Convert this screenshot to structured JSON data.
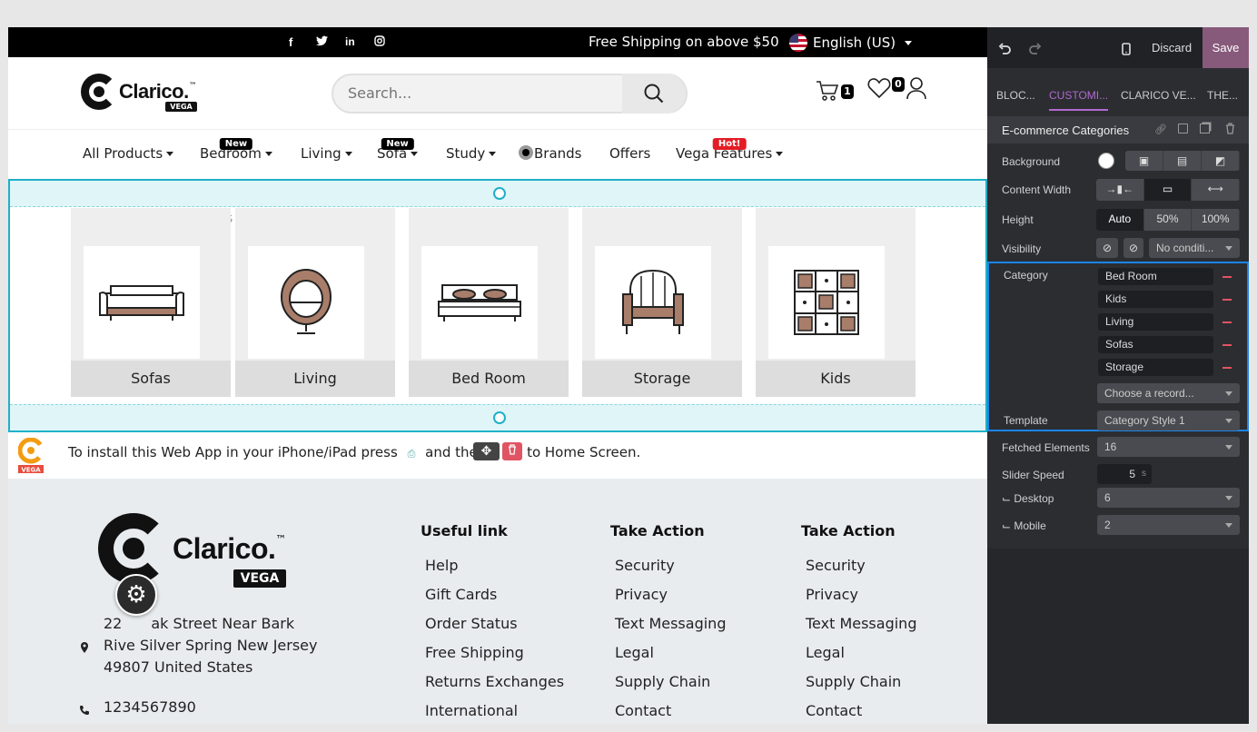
{
  "topbar": {
    "shipping_text": "Free Shipping on above $50",
    "language": "English (US)",
    "social_icons": [
      "facebook-icon",
      "twitter-icon",
      "linkedin-icon",
      "instagram-icon"
    ]
  },
  "header": {
    "logo_text": "Clarico.",
    "logo_tm": "™",
    "logo_sub": "VEGA",
    "search_placeholder": "Search...",
    "cart_count": "1",
    "wishlist_count": "0"
  },
  "nav": {
    "items": [
      {
        "label": "All Products",
        "caret": true,
        "tag": ""
      },
      {
        "label": "Bedroom",
        "caret": true,
        "tag": "New"
      },
      {
        "label": "Living",
        "caret": true,
        "tag": ""
      },
      {
        "label": "Sofa",
        "caret": true,
        "tag": "New"
      },
      {
        "label": "Study",
        "caret": true,
        "tag": ""
      },
      {
        "label": "Brands",
        "caret": false,
        "tag": ""
      },
      {
        "label": "Offers",
        "caret": false,
        "tag": ""
      },
      {
        "label": "Vega Features",
        "caret": true,
        "tag": "Hot!"
      }
    ]
  },
  "categories_block": {
    "ghost_text": "ds",
    "cards": [
      {
        "label": "Sofas",
        "icon": "sofa-icon"
      },
      {
        "label": "Living",
        "icon": "egg-chair-icon"
      },
      {
        "label": "Bed Room",
        "icon": "bed-icon"
      },
      {
        "label": "Storage",
        "icon": "armchair-icon"
      },
      {
        "label": "Kids",
        "icon": "cabinet-icon"
      }
    ]
  },
  "install_bar": {
    "text_before": "To install this Web App in your iPhone/iPad press",
    "text_after": "and then",
    "text_end": "to Home Screen."
  },
  "footer": {
    "address_lines": [
      "22",
      "ak Street Near Bark",
      "Rive Silver Spring New Jersey",
      "49807 United States"
    ],
    "phone": "1234567890",
    "columns": [
      {
        "title": "Useful link",
        "items": [
          "Help",
          "Gift Cards",
          "Order Status",
          "Free Shipping",
          "Returns Exchanges",
          "International"
        ]
      },
      {
        "title": "Take Action",
        "items": [
          "Security",
          "Privacy",
          "Text Messaging",
          "Legal",
          "Supply Chain",
          "Contact"
        ]
      },
      {
        "title": "Take Action",
        "items": [
          "Security",
          "Privacy",
          "Text Messaging",
          "Legal",
          "Supply Chain",
          "Contact"
        ]
      }
    ]
  },
  "panel": {
    "discard": "Discard",
    "save": "Save",
    "tabs": [
      "BLOC...",
      "CUSTOMI...",
      "CLARICO VE...",
      "THE..."
    ],
    "section_title": "E-commerce Categories",
    "background_label": "Background",
    "content_width_label": "Content Width",
    "height_label": "Height",
    "height_options": [
      "Auto",
      "50%",
      "100%"
    ],
    "visibility_label": "Visibility",
    "visibility_value": "No conditi...",
    "category_label": "Category",
    "categories": [
      "Bed Room",
      "Kids",
      "Living",
      "Sofas",
      "Storage"
    ],
    "choose_record": "Choose a record...",
    "template_label": "Template",
    "template_value": "Category Style 1",
    "fetched_label": "Fetched Elements",
    "fetched_value": "16",
    "slider_label": "Slider Speed",
    "slider_value": "5",
    "slider_unit": "s",
    "desktop_label": "⌙ Desktop",
    "desktop_value": "6",
    "mobile_label": "⌙ Mobile",
    "mobile_value": "2",
    "accent": "#875a7b",
    "active_tab_color": "#b06ad0",
    "selection_color": "#1b84e8"
  },
  "colors": {
    "block_outline": "#1fb0c8",
    "hot_tag": "#e31c25"
  }
}
